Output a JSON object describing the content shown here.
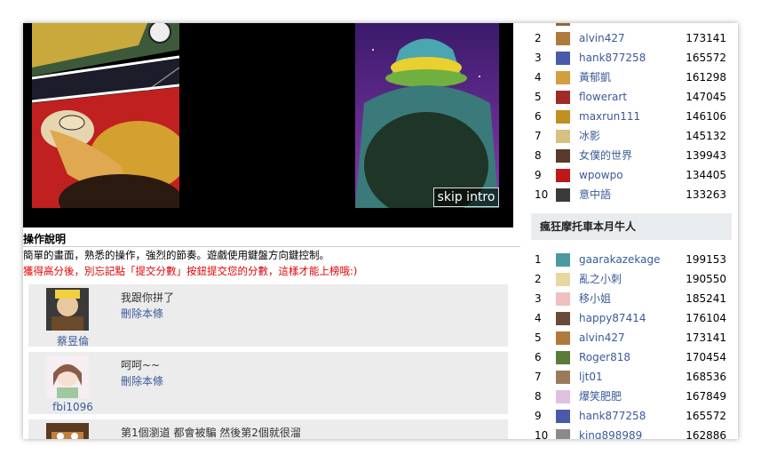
{
  "game": {
    "skip_label": "skip intro"
  },
  "instructions": {
    "title": "操作說明",
    "line1": "簡單的畫面，熟悉的操作，強烈的節奏。遊戲使用鍵盤方向鍵控制。",
    "line2": "獲得高分後，別忘記點「提交分數」按鈕提交您的分數，這樣才能上榜哦:)"
  },
  "comments": [
    {
      "user": "蔡昱倫",
      "text": "我跟你拼了",
      "delete_label": "刪除本條"
    },
    {
      "user": "fbi1096",
      "text": "呵呵~~",
      "delete_label": "刪除本條"
    },
    {
      "user": "",
      "text": "第1個瀏道 都會被騙 然後第2個就很溜",
      "delete_label": ""
    }
  ],
  "ranking_top": [
    {
      "rank": "2",
      "name": "alvin427",
      "score": "173141"
    },
    {
      "rank": "3",
      "name": "hank877258",
      "score": "165572"
    },
    {
      "rank": "4",
      "name": "黃郁凱",
      "score": "161298"
    },
    {
      "rank": "5",
      "name": "flowerart",
      "score": "147045"
    },
    {
      "rank": "6",
      "name": "maxrun111",
      "score": "146106"
    },
    {
      "rank": "7",
      "name": "冰影",
      "score": "145132"
    },
    {
      "rank": "8",
      "name": "女僕的世界",
      "score": "139943"
    },
    {
      "rank": "9",
      "name": "wpowpo",
      "score": "134405"
    },
    {
      "rank": "10",
      "name": "意中語",
      "score": "133263"
    }
  ],
  "monthly_section": {
    "title": "瘋狂摩托車本月牛人"
  },
  "ranking_month": [
    {
      "rank": "1",
      "name": "gaarakazekage",
      "score": "199153"
    },
    {
      "rank": "2",
      "name": "亂之小刺",
      "score": "190550"
    },
    {
      "rank": "3",
      "name": "移小姐",
      "score": "185241"
    },
    {
      "rank": "4",
      "name": "happy87414",
      "score": "176104"
    },
    {
      "rank": "5",
      "name": "alvin427",
      "score": "173141"
    },
    {
      "rank": "6",
      "name": "Roger818",
      "score": "170454"
    },
    {
      "rank": "7",
      "name": "ljt01",
      "score": "168536"
    },
    {
      "rank": "8",
      "name": "爆笑肥肥",
      "score": "167849"
    },
    {
      "rank": "9",
      "name": "hank877258",
      "score": "165572"
    },
    {
      "rank": "10",
      "name": "king898989",
      "score": "162886"
    }
  ],
  "colors": {
    "link": "#3a5a9a",
    "warning": "#e00000",
    "section_bg": "#e9ecef",
    "comment_bg": "#ececec"
  }
}
